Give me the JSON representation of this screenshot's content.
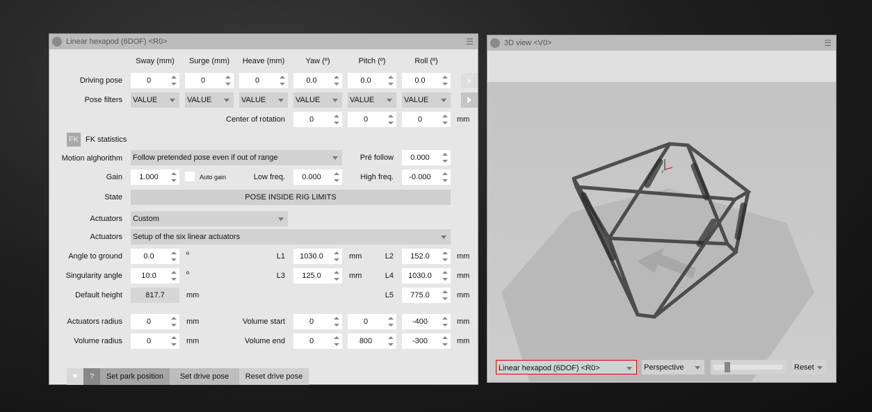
{
  "left_panel": {
    "title": "Linear hexapod (6DOF) <R0>",
    "columns": [
      "Sway (mm)",
      "Surge (mm)",
      "Heave (mm)",
      "Yaw (º)",
      "Pitch (º)",
      "Roll (º)"
    ],
    "driving_pose": {
      "label": "Driving pose",
      "values": [
        "0",
        "0",
        "0",
        "0.0",
        "0.0",
        "0.0"
      ]
    },
    "pose_filters": {
      "label": "Pose filters",
      "values": [
        "VALUE",
        "VALUE",
        "VALUE",
        "VALUE",
        "VALUE",
        "VALUE"
      ]
    },
    "center_of_rotation": {
      "label": "Center of rotation",
      "values": [
        "0",
        "0",
        "0"
      ],
      "unit": "mm"
    },
    "fk": {
      "badge": "FK",
      "label": "FK statistics"
    },
    "motion": {
      "label": "Motion alghorithm",
      "value": "Follow pretended pose even if out of range",
      "pre_follow_label": "Pré follow",
      "pre_follow": "0.000"
    },
    "gain": {
      "label": "Gain",
      "value": "1.000",
      "auto_gain": "Auto gain",
      "auto_gain_checked": false,
      "low_label": "Low freq.",
      "low": "0.000",
      "high_label": "High freq.",
      "high": "-0.000"
    },
    "state": {
      "label": "State",
      "value": "POSE INSIDE RIG LIMITS"
    },
    "actuators_type": {
      "label": "Actuators",
      "value": "Custom"
    },
    "actuators_setup": {
      "label": "Actuators",
      "value": "Setup of the six linear actuators"
    },
    "angle_to_ground": {
      "label": "Angle to ground",
      "value": "0.0",
      "unit": "º"
    },
    "singularity_angle": {
      "label": "Singularity angle",
      "value": "10.0",
      "unit": "º"
    },
    "default_height": {
      "label": "Default height",
      "value": "817.7",
      "unit": "mm"
    },
    "lengths": [
      {
        "label": "L1",
        "value": "1030.0",
        "unit": "mm"
      },
      {
        "label": "L2",
        "value": "152.0",
        "unit": "mm"
      },
      {
        "label": "L3",
        "value": "125.0",
        "unit": "mm"
      },
      {
        "label": "L4",
        "value": "1030.0",
        "unit": "mm"
      },
      {
        "label": "L5",
        "value": "775.0",
        "unit": "mm"
      }
    ],
    "actuators_radius": {
      "label": "Actuators radius",
      "value": "0",
      "unit": "mm"
    },
    "volume_radius": {
      "label": "Volume radius",
      "value": "0",
      "unit": "mm"
    },
    "volume_start": {
      "label": "Volume start",
      "values": [
        "0",
        "0",
        "-400"
      ],
      "unit": "mm"
    },
    "volume_end": {
      "label": "Volume end",
      "values": [
        "0",
        "800",
        "-300"
      ],
      "unit": "mm"
    },
    "footer": {
      "help": "?",
      "set_park": "Set park position",
      "set_drive": "Set drive pose",
      "reset_drive": "Reset drive pose"
    }
  },
  "view_panel": {
    "title": "3D view <V0>",
    "object_select": "Linear hexapod (6DOF) <R0>",
    "projection": "Perspective",
    "reset": "Reset",
    "accent_color": "#e00000"
  }
}
